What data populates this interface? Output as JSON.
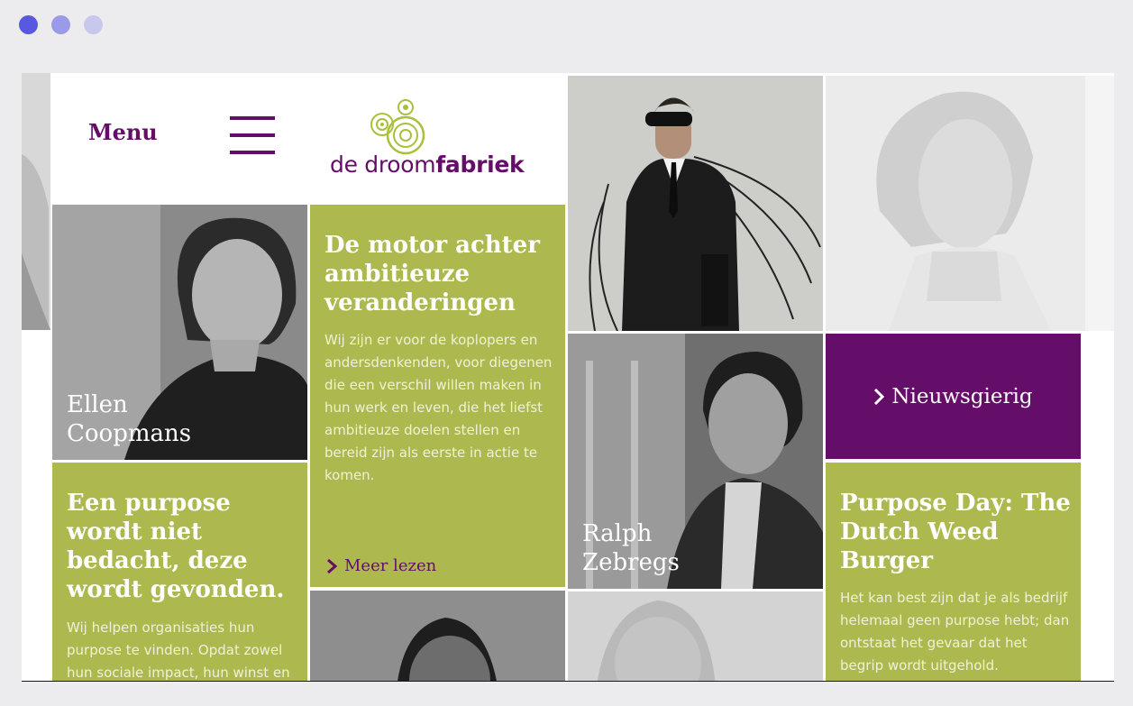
{
  "window": {
    "dots": [
      "#5858e0",
      "#9a9ae8",
      "#c8c8ee"
    ]
  },
  "menu": {
    "label": "Menu"
  },
  "logo": {
    "text_light": "de droom",
    "text_bold": "fabriek"
  },
  "tiles": {
    "ellen": {
      "name": "Ellen\nCoopmans"
    },
    "motor": {
      "title": "De motor achter ambitieuze veranderingen",
      "body": "Wij zijn er voor de koplopers en andersdenkenden, voor diegenen die een verschil willen maken in hun werk en leven, die het liefst ambitieuze doelen stellen en bereid zijn als eerste in actie te komen.",
      "link": "Meer lezen"
    },
    "ralph": {
      "name": "Ralph\nZebregs"
    },
    "nieuwsgierig": {
      "label": "Nieuwsgierig"
    },
    "purpose": {
      "title": "Een purpose wordt niet bedacht, deze wordt gevonden.",
      "body": "Wij helpen organisaties hun purpose te vinden. Opdat zowel hun sociale impact, hun winst en"
    },
    "purpose_day": {
      "title": "Purpose Day: The Dutch Weed Burger",
      "body": "Het kan best zijn dat je als bedrijf helemaal geen purpose hebt; dan ontstaat het gevaar dat het begrip wordt uitgehold."
    }
  },
  "colors": {
    "green": "#adb94e",
    "purple": "#640e6a",
    "logo_green": "#a9c03a"
  }
}
